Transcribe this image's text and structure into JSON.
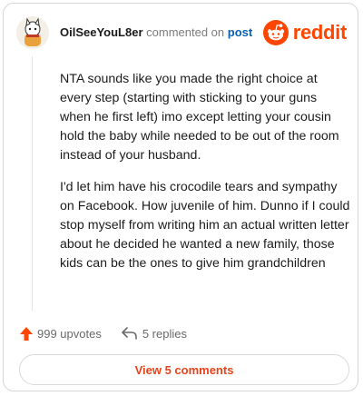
{
  "header": {
    "username": "OilSeeYouL8er",
    "action_text": "commented on",
    "post_link": "post",
    "brand": "reddit"
  },
  "comment": {
    "paragraphs": [
      "NTA sounds like you made the right choice at every step (starting with sticking to your guns when he first left) imo except letting your cousin hold the baby while needed to be out of the room instead of your husband.",
      "I'd let him have his crocodile tears and sympathy on Facebook. How juvenile of him. Dunno if I could stop myself from writing him an actual written letter about he decided he wanted a new family, those kids can be the ones to give him grandchildren"
    ]
  },
  "actions": {
    "upvotes_label": "999 upvotes",
    "replies_label": "5 replies",
    "upvote_icon": "upvote-arrow-icon",
    "reply_icon": "reply-arrow-icon"
  },
  "footer": {
    "view_comments_label": "View 5 comments"
  },
  "colors": {
    "brand": "#ff4500",
    "link": "#0a5fb0",
    "view_button_text": "#e8431b",
    "upvote": "#ff4500"
  }
}
